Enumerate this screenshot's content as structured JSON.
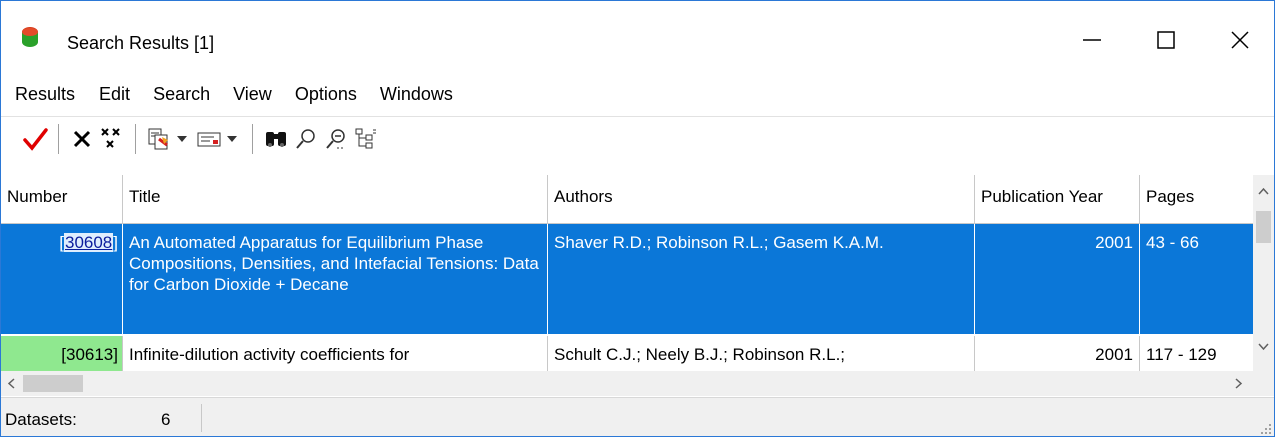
{
  "window": {
    "title": "Search Results [1]"
  },
  "menu": [
    "Results",
    "Edit",
    "Search",
    "View",
    "Options",
    "Windows"
  ],
  "toolbar": {
    "icons": [
      "checkmark-icon",
      "delete-icon",
      "delete-all-icon",
      "copy-export-icon",
      "dropdown",
      "message-icon",
      "dropdown",
      "binoculars-icon",
      "zoom-icon",
      "zoom-out-icon",
      "tree-view-icon"
    ]
  },
  "grid": {
    "columns": [
      "Number",
      "Title",
      "Authors",
      "Publication Year",
      "Pages"
    ],
    "rows": [
      {
        "number": "30608",
        "title": "An Automated Apparatus for Equilibrium Phase Compositions, Densities, and Intefacial Tensions: Data for Carbon Dioxide + Decane",
        "authors": "Shaver R.D.; Robinson R.L.; Gasem K.A.M.",
        "year": "2001",
        "pages": "43 - 66",
        "selected": true
      },
      {
        "number": "[30613]",
        "title": "Infinite-dilution activity coefficients for",
        "authors": "Schult C.J.; Neely B.J.; Robinson R.L.;",
        "year": "2001",
        "pages": "117 - 129",
        "selected": false
      }
    ]
  },
  "status": {
    "label": "Datasets:",
    "value": "6"
  },
  "colors": {
    "selection": "#0b77d8",
    "row_marker": "#8fe88f",
    "window_border": "#2b78d6"
  }
}
